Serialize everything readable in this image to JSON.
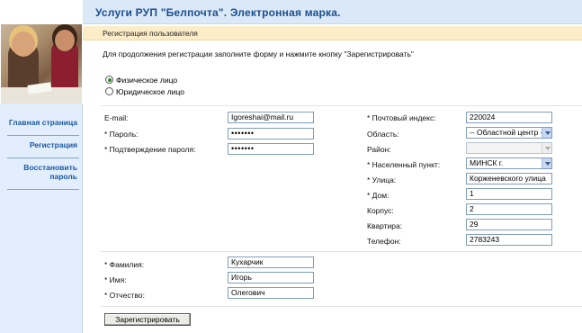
{
  "header": {
    "title": "Услуги РУП \"Белпочта\". Электронная марка."
  },
  "nav": {
    "items": [
      {
        "label": "Главная страница"
      },
      {
        "label": "Регистрация"
      },
      {
        "label": "Восстановить пароль"
      }
    ]
  },
  "section": {
    "title": "Регистрация пользователя"
  },
  "instruction": "Для продолжения регистрации заполните форму и нажмите кнопку \"Зарегистрировать\"",
  "user_type": {
    "options": [
      {
        "label": "Физическое лицо",
        "checked": true
      },
      {
        "label": "Юридическое лицо",
        "checked": false
      }
    ]
  },
  "account": {
    "email_label": "E-mail:",
    "email_value": "Igoreshai@mail.ru",
    "password_label": "* Пароль:",
    "password_value": "•••••••",
    "confirm_label": "* Подтверждение пароля:",
    "confirm_value": "•••••••"
  },
  "address": {
    "postal_label": "* Почтовый индекс:",
    "postal_value": "220024",
    "region_label": "Область:",
    "region_value": "-- Областной центр --",
    "district_label": "Район:",
    "district_value": "",
    "city_label": "* Населенный пункт:",
    "city_value": "МИНСК г.",
    "street_label": "* Улица:",
    "street_value": "Корженевского улица",
    "house_label": "* Дом:",
    "house_value": "1",
    "building_label": "Корпус:",
    "building_value": "2",
    "apartment_label": "Квартира:",
    "apartment_value": "29",
    "phone_label": "Телефон:",
    "phone_value": "2783243"
  },
  "person": {
    "lastname_label": "* Фамилия:",
    "lastname_value": "Кухарчик",
    "firstname_label": "* Имя:",
    "firstname_value": "Игорь",
    "patronymic_label": "* Отчество:",
    "patronymic_value": "Олегович"
  },
  "submit_label": "Зарегистрировать",
  "colors": {
    "header_bg": "#dbe8f7",
    "header_text": "#1a4f8f",
    "section_bg": "#fcecc8",
    "nav_bg": "#e2eefb",
    "nav_link": "#1a58a6"
  }
}
